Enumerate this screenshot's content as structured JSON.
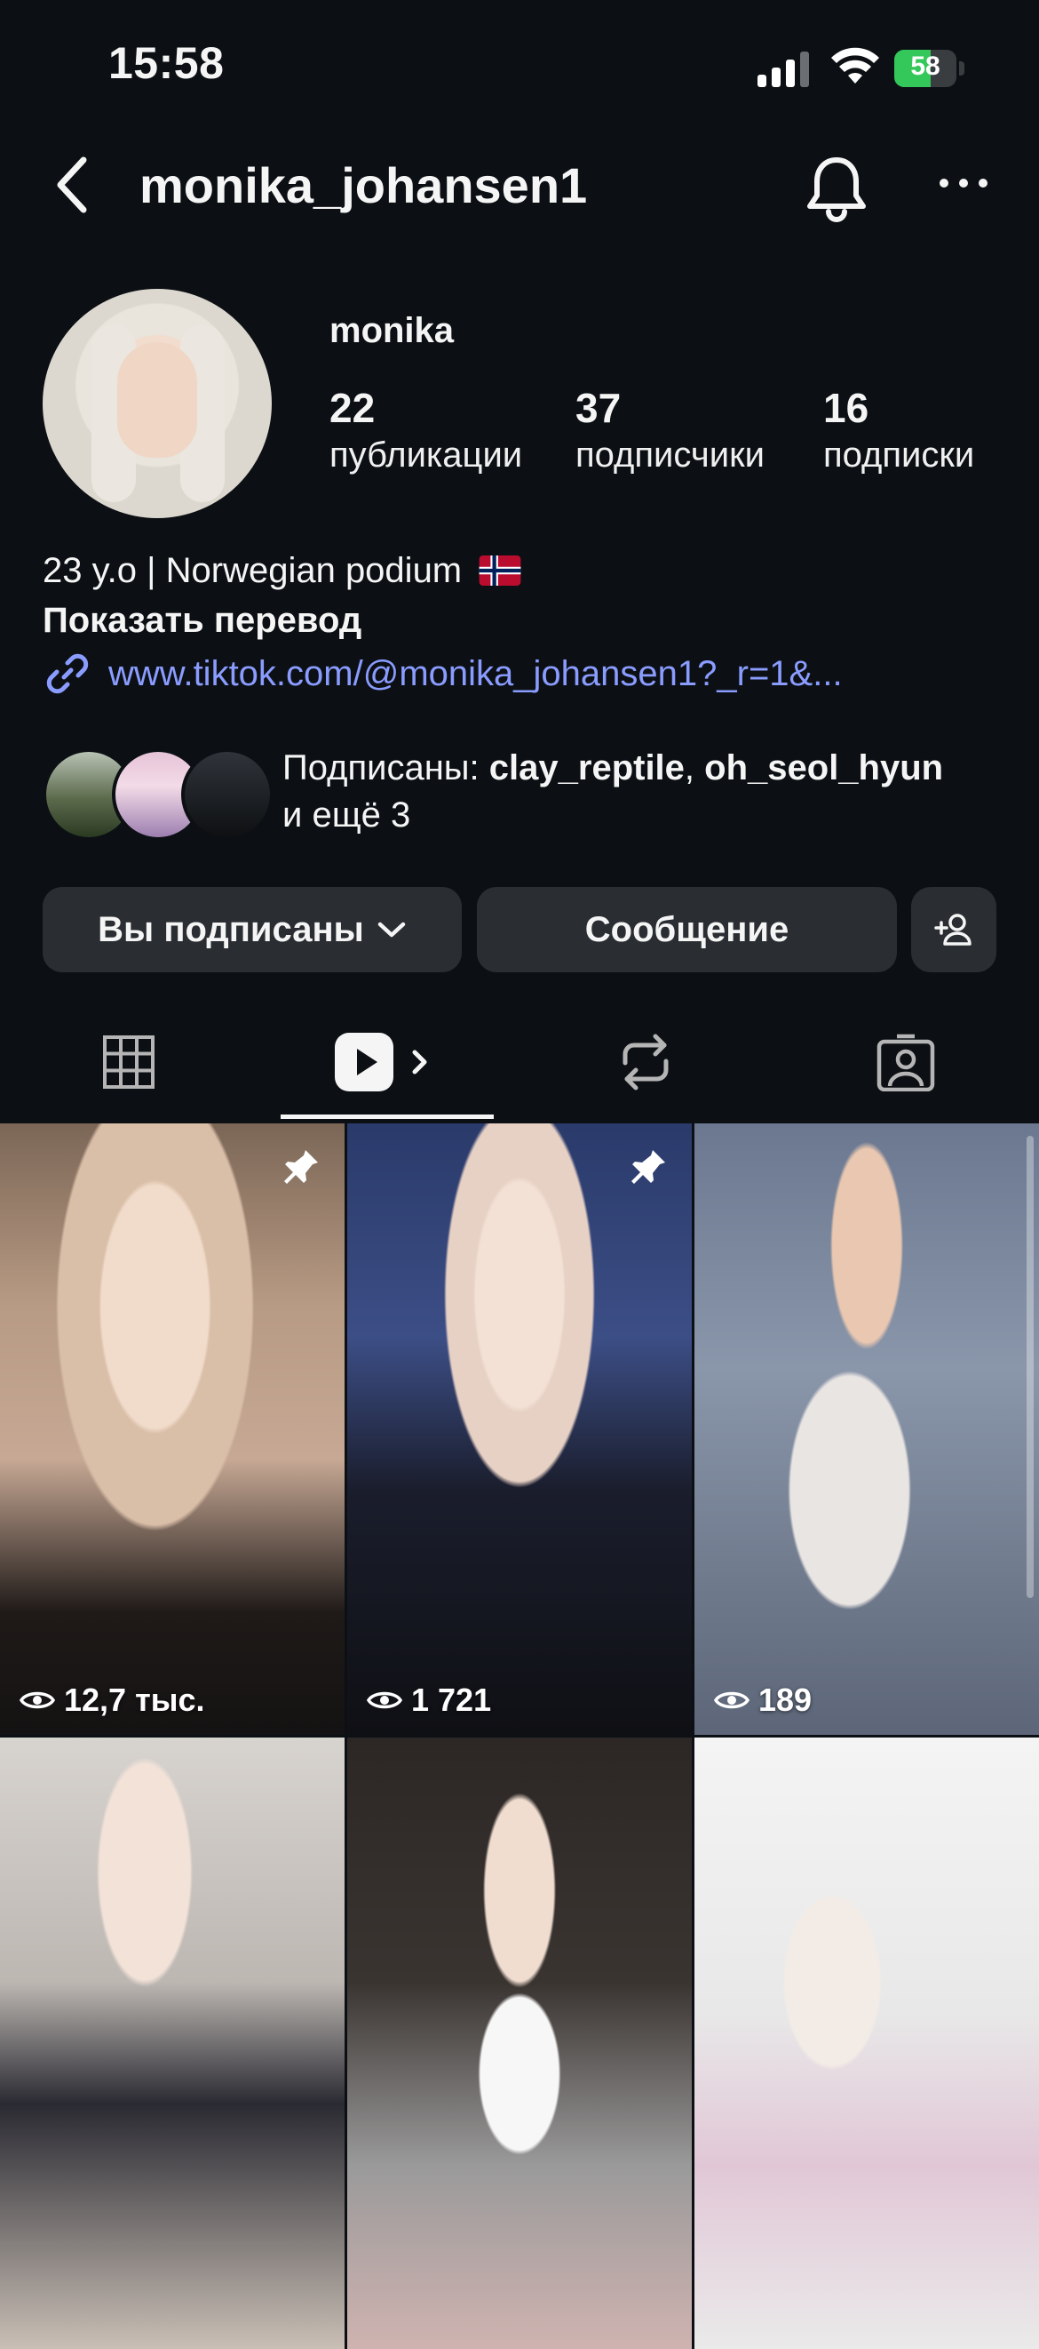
{
  "status_bar": {
    "time": "15:58",
    "battery_level": "58",
    "battery_fraction": 0.58
  },
  "header": {
    "username": "monika_johansen1"
  },
  "profile": {
    "display_name": "monika",
    "stats": [
      {
        "value": "22",
        "label": "публикации"
      },
      {
        "value": "37",
        "label": "подписчики"
      },
      {
        "value": "16",
        "label": "подписки"
      }
    ],
    "bio": "23 y.o | Norwegian podium",
    "translate_label": "Показать перевод",
    "link": "www.tiktok.com/@monika_johansen1?_r=1&..."
  },
  "mutuals": {
    "prefix": "Подписаны: ",
    "name1": "clay_reptile",
    "separator": ", ",
    "name2": "oh_seol_hyun",
    "suffix": "и ещё 3"
  },
  "actions": {
    "following_label": "Вы подписаны",
    "message_label": "Сообщение"
  },
  "tabs": [
    "grid-icon",
    "reels-icon",
    "repost-icon",
    "tagged-icon"
  ],
  "active_tab": "reels",
  "reels": [
    {
      "views": "12,7 тыс.",
      "pinned": true
    },
    {
      "views": "1 721",
      "pinned": true
    },
    {
      "views": "189",
      "pinned": false
    },
    {
      "views": "",
      "pinned": false
    },
    {
      "views": "",
      "pinned": false
    },
    {
      "views": "",
      "pinned": false
    }
  ],
  "colors": {
    "background": "#0c1014",
    "button": "#2a2e33",
    "link": "#8a9cff",
    "battery": "#34c759"
  }
}
